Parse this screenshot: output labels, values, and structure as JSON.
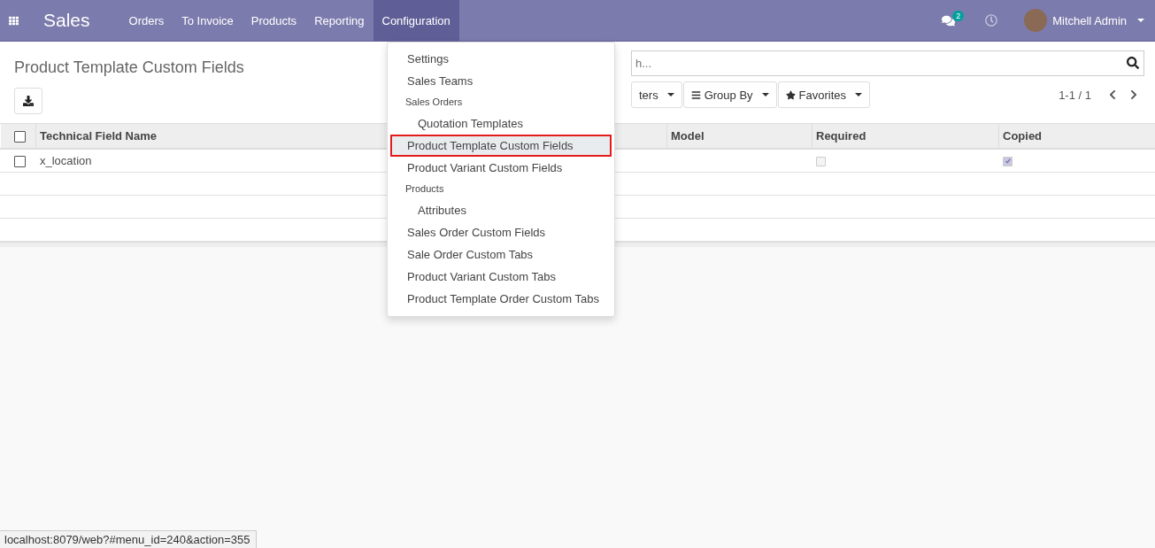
{
  "navbar": {
    "app_name": "Sales",
    "menu": [
      {
        "label": "Orders",
        "selected": false
      },
      {
        "label": "To Invoice",
        "selected": false
      },
      {
        "label": "Products",
        "selected": false
      },
      {
        "label": "Reporting",
        "selected": false
      },
      {
        "label": "Configuration",
        "selected": true
      }
    ],
    "messages_badge": "2",
    "user_name": "Mitchell Admin"
  },
  "dropdown": {
    "items": [
      {
        "kind": "item",
        "label": "Settings",
        "selected": false
      },
      {
        "kind": "item",
        "label": "Sales Teams",
        "selected": false
      },
      {
        "kind": "header",
        "label": "Sales Orders"
      },
      {
        "kind": "subitem",
        "label": "Quotation Templates",
        "selected": false
      },
      {
        "kind": "item",
        "label": "Product Template Custom Fields",
        "selected": true
      },
      {
        "kind": "item",
        "label": "Product Variant Custom Fields",
        "selected": false
      },
      {
        "kind": "header",
        "label": "Products"
      },
      {
        "kind": "subitem",
        "label": "Attributes",
        "selected": false
      },
      {
        "kind": "item",
        "label": "Sales Order Custom Fields",
        "selected": false
      },
      {
        "kind": "item",
        "label": "Sale Order Custom Tabs",
        "selected": false
      },
      {
        "kind": "item",
        "label": "Product Variant Custom Tabs",
        "selected": false
      },
      {
        "kind": "item",
        "label": "Product Template Order Custom Tabs",
        "selected": false
      }
    ]
  },
  "control_panel": {
    "title": "Product Template Custom Fields",
    "search": {
      "placeholder": "h..."
    },
    "filter_buttons": [
      {
        "kind": "filters",
        "label": "ters"
      },
      {
        "kind": "group",
        "label": "Group By"
      },
      {
        "kind": "favorites",
        "label": "Favorites"
      }
    ],
    "pager": "1-1 / 1"
  },
  "table": {
    "columns": [
      "Technical Field Name",
      "Model",
      "Required",
      "Copied"
    ],
    "all_selected": false,
    "rows": [
      {
        "selected": false,
        "name": "x_location",
        "model": "",
        "required": false,
        "copied": true
      }
    ]
  },
  "status_bar": "localhost:8079/web?#menu_id=240&action=355"
}
